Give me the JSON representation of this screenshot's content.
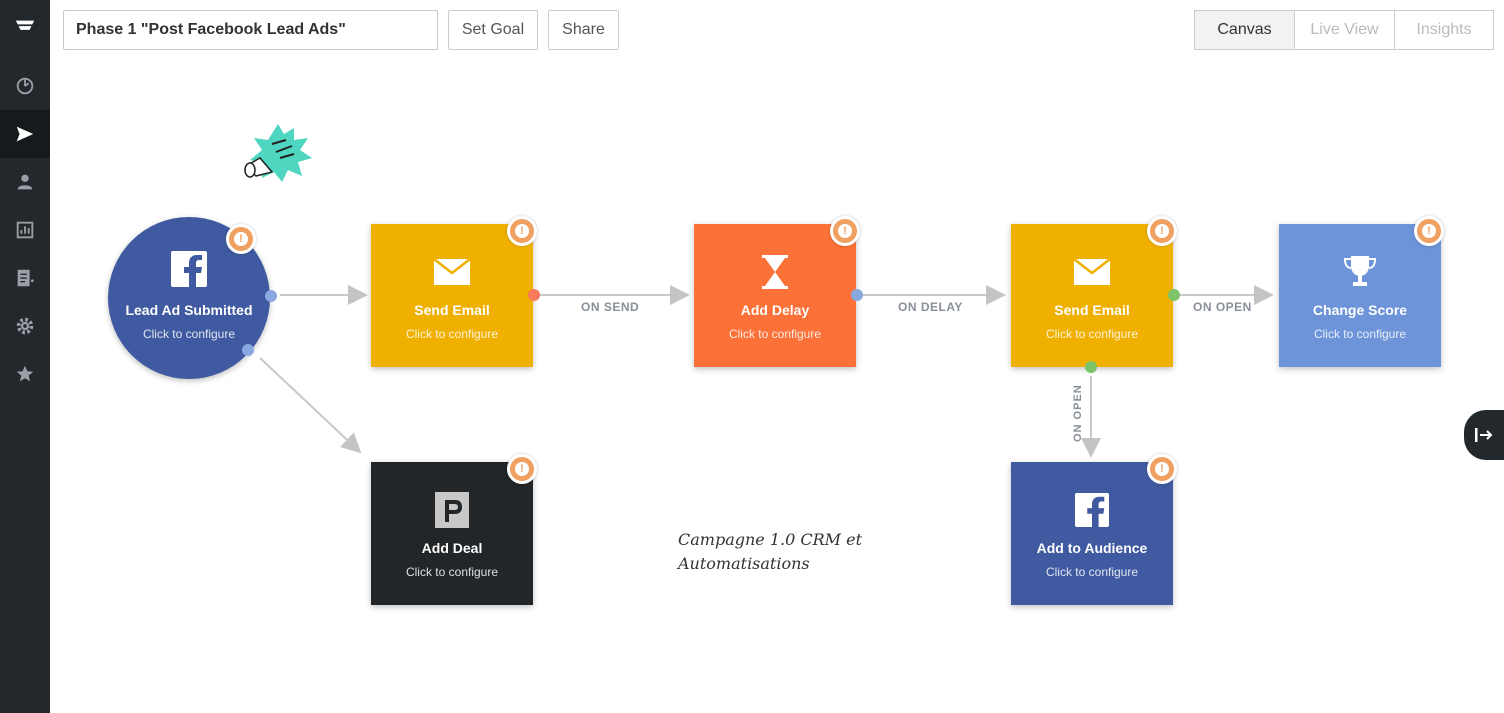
{
  "sidebar": {
    "items": [
      {
        "icon": "logo-icon"
      },
      {
        "icon": "dashboard-icon"
      },
      {
        "icon": "send-icon",
        "active": true
      },
      {
        "icon": "contact-icon"
      },
      {
        "icon": "reports-icon"
      },
      {
        "icon": "forms-icon"
      },
      {
        "icon": "settings-icon"
      },
      {
        "icon": "star-icon"
      }
    ]
  },
  "toolbar": {
    "title_value": "Phase 1 \"Post Facebook Lead Ads\"",
    "set_goal_label": "Set Goal",
    "share_label": "Share",
    "views": [
      {
        "label": "Canvas",
        "active": true
      },
      {
        "label": "Live View",
        "active": false
      },
      {
        "label": "Insights",
        "active": false
      }
    ]
  },
  "canvas": {
    "nodes": {
      "lead_ad": {
        "title": "Lead Ad Submitted",
        "subtitle": "Click to configure",
        "icon": "facebook-icon",
        "color": "#3f5aa0"
      },
      "send_email_1": {
        "title": "Send Email",
        "subtitle": "Click to configure",
        "icon": "envelope-icon",
        "color": "#f0b000"
      },
      "add_delay": {
        "title": "Add Delay",
        "subtitle": "Click to configure",
        "icon": "hourglass-icon",
        "color": "#fb7137"
      },
      "send_email_2": {
        "title": "Send Email",
        "subtitle": "Click to configure",
        "icon": "envelope-icon",
        "color": "#f0b000"
      },
      "change_score": {
        "title": "Change Score",
        "subtitle": "Click to configure",
        "icon": "trophy-icon",
        "color": "#6d94d8"
      },
      "add_deal": {
        "title": "Add Deal",
        "subtitle": "Click to configure",
        "icon": "pipedrive-icon",
        "color": "#222629"
      },
      "add_audience": {
        "title": "Add to Audience",
        "subtitle": "Click to configure",
        "icon": "facebook-icon",
        "color": "#3f5aa0"
      }
    },
    "edges": {
      "on_send": "ON SEND",
      "on_delay": "ON DELAY",
      "on_open_right": "ON OPEN",
      "on_open_down": "ON OPEN"
    },
    "note": [
      "Campagne 1.0 CRM et",
      "Automatisations"
    ],
    "warning_glyph": "!"
  }
}
